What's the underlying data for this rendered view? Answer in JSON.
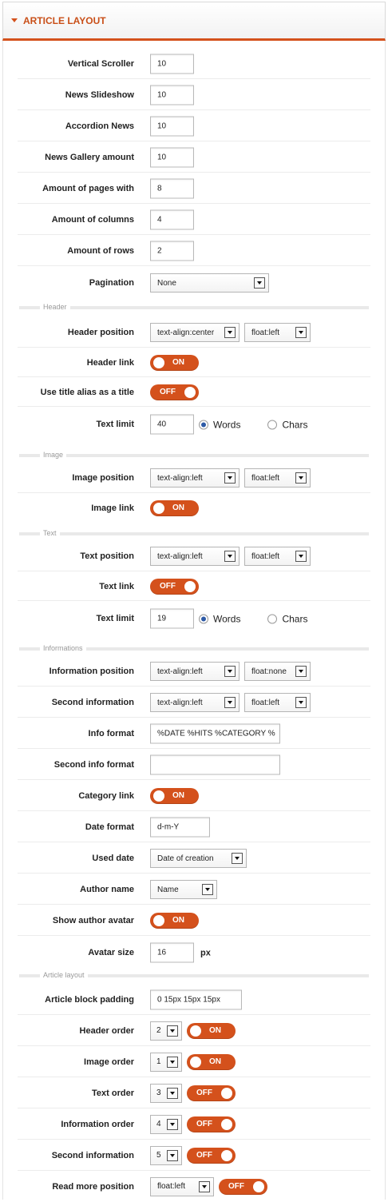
{
  "panel": {
    "title": "Article Layout",
    "accent_color": "#d4511c"
  },
  "fields": {
    "vertical_scroller": {
      "label": "Vertical Scroller",
      "value": "10"
    },
    "news_slideshow": {
      "label": "News Slideshow",
      "value": "10"
    },
    "accordion_news": {
      "label": "Accordion News",
      "value": "10"
    },
    "news_gallery_amount": {
      "label": "News Gallery amount",
      "value": "10"
    },
    "amount_pages": {
      "label": "Amount of pages with",
      "value": "8"
    },
    "amount_columns": {
      "label": "Amount of columns",
      "value": "4"
    },
    "amount_rows": {
      "label": "Amount of rows",
      "value": "2"
    },
    "pagination": {
      "label": "Pagination",
      "value": "None"
    },
    "header_section": "Header",
    "header_position": {
      "label": "Header position",
      "align": "text-align:center",
      "float": "float:left"
    },
    "header_link": {
      "label": "Header link",
      "state": "ON"
    },
    "use_title_alias": {
      "label": "Use title alias as a title",
      "state": "OFF"
    },
    "header_text_limit": {
      "label": "Text limit",
      "value": "40",
      "opt1": "Words",
      "opt2": "Chars"
    },
    "image_section": "Image",
    "image_position": {
      "label": "Image position",
      "align": "text-align:left",
      "float": "float:left"
    },
    "image_link": {
      "label": "Image link",
      "state": "ON"
    },
    "text_section": "Text",
    "text_position": {
      "label": "Text position",
      "align": "text-align:left",
      "float": "float:left"
    },
    "text_link": {
      "label": "Text link",
      "state": "OFF"
    },
    "text_text_limit": {
      "label": "Text limit",
      "value": "19",
      "opt1": "Words",
      "opt2": "Chars"
    },
    "info_section": "Informations",
    "information_position": {
      "label": "Information position",
      "align": "text-align:left",
      "float": "float:none"
    },
    "second_information": {
      "label": "Second information",
      "align": "text-align:left",
      "float": "float:left"
    },
    "info_format": {
      "label": "Info format",
      "value": "%DATE %HITS %CATEGORY %"
    },
    "second_info_format": {
      "label": "Second info format",
      "value": ""
    },
    "category_link": {
      "label": "Category link",
      "state": "ON"
    },
    "date_format": {
      "label": "Date format",
      "value": "d-m-Y"
    },
    "used_date": {
      "label": "Used date",
      "value": "Date of creation"
    },
    "author_name": {
      "label": "Author name",
      "value": "Name"
    },
    "show_author_avatar": {
      "label": "Show author avatar",
      "state": "ON"
    },
    "avatar_size": {
      "label": "Avatar size",
      "value": "16",
      "unit": "px"
    },
    "layout_section": "Article layout",
    "article_block_padding": {
      "label": "Article block padding",
      "value": "0 15px 15px 15px"
    },
    "header_order": {
      "label": "Header order",
      "value": "2",
      "state": "ON"
    },
    "image_order": {
      "label": "Image order",
      "value": "1",
      "state": "ON"
    },
    "text_order": {
      "label": "Text order",
      "value": "3",
      "state": "OFF"
    },
    "information_order": {
      "label": "Information order",
      "value": "4",
      "state": "OFF"
    },
    "second_information_order": {
      "label": "Second information",
      "value": "5",
      "state": "OFF"
    },
    "read_more_position": {
      "label": "Read more position",
      "value": "float:left",
      "state": "OFF"
    }
  }
}
